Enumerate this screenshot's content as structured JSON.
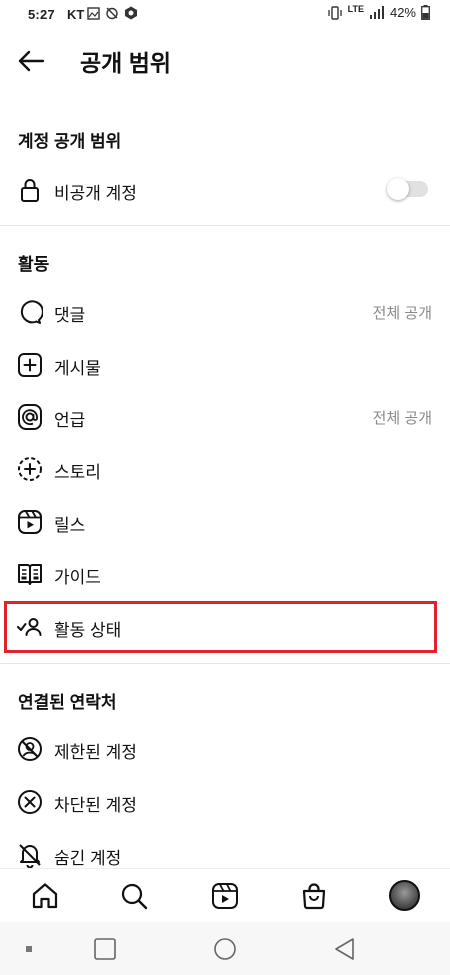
{
  "status_bar": {
    "time": "5:27",
    "carrier": "KT",
    "network": "LTE",
    "battery": "42%"
  },
  "header": {
    "title": "공개 범위"
  },
  "account_privacy": {
    "section_title": "계정 공개 범위",
    "private_account": {
      "label": "비공개 계정",
      "enabled": false
    }
  },
  "activity": {
    "section_title": "활동",
    "items": [
      {
        "label": "댓글",
        "value": "전체 공개",
        "icon": "comment-icon"
      },
      {
        "label": "게시물",
        "value": "",
        "icon": "plus-square-icon"
      },
      {
        "label": "언급",
        "value": "전체 공개",
        "icon": "at-sign-icon"
      },
      {
        "label": "스토리",
        "value": "",
        "icon": "story-icon"
      },
      {
        "label": "릴스",
        "value": "",
        "icon": "reels-icon"
      },
      {
        "label": "가이드",
        "value": "",
        "icon": "guide-book-icon"
      },
      {
        "label": "활동 상태",
        "value": "",
        "icon": "activity-status-icon"
      }
    ]
  },
  "connections": {
    "section_title": "연결된 연락처",
    "items": [
      {
        "label": "제한된 계정",
        "icon": "restricted-icon"
      },
      {
        "label": "차단된 계정",
        "icon": "blocked-icon"
      },
      {
        "label": "숨긴 계정",
        "icon": "muted-bell-icon"
      }
    ]
  },
  "bottom_nav": [
    "home-icon",
    "search-icon",
    "reels-icon",
    "shop-icon",
    "profile-avatar"
  ],
  "colors": {
    "highlight": "#e0222d",
    "muted_text": "#8a8a8a",
    "divider": "#e6e6e6"
  }
}
